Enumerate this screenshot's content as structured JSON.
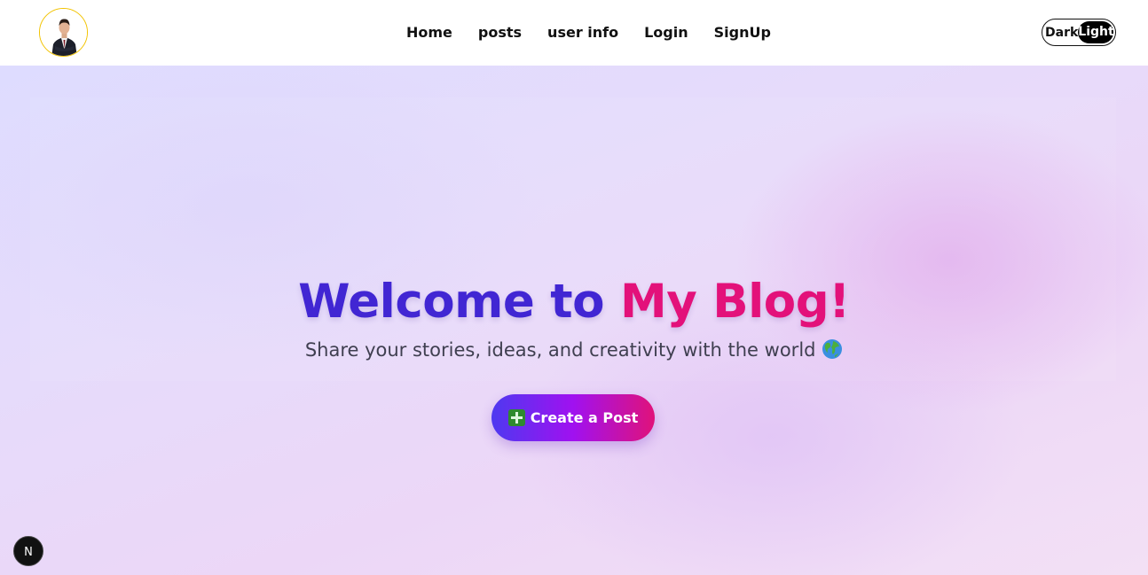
{
  "nav": {
    "links": [
      "Home",
      "posts",
      "user info",
      "Login",
      "SignUp"
    ],
    "theme_toggle": {
      "dark_label": "Dark",
      "light_label": "Light",
      "active": "Light"
    }
  },
  "hero": {
    "title_part1": "Welcome to",
    "title_part2": "My Blog!",
    "subtitle": "Share your stories, ideas, and creativity with the world",
    "subtitle_icon": "globe-icon",
    "cta_label": "Create a Post",
    "cta_icon": "plus-icon"
  },
  "badge": {
    "label": "N"
  },
  "colors": {
    "title_primary": "#4126d3",
    "title_accent": "#e3117a",
    "avatar_ring": "#f2c300"
  }
}
